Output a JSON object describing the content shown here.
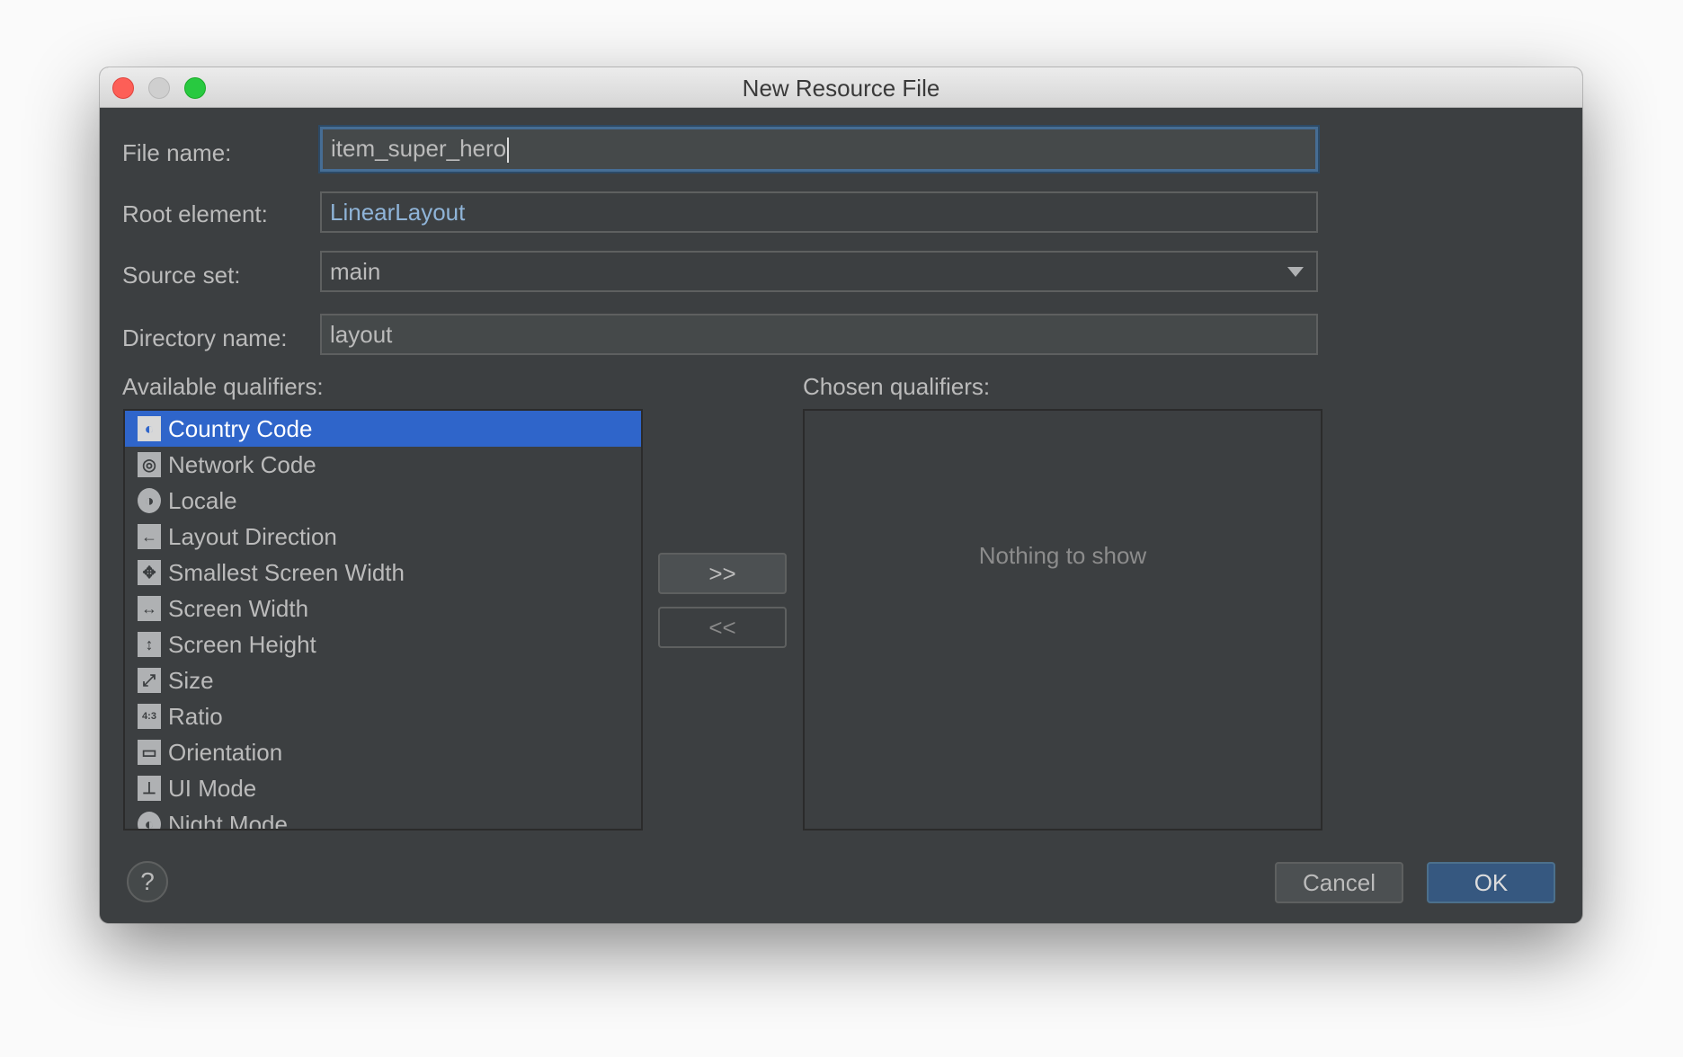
{
  "window": {
    "title": "New Resource File"
  },
  "form": {
    "file_name": {
      "label": "File name:",
      "value": "item_super_hero"
    },
    "root_element": {
      "label": "Root element:",
      "value": "LinearLayout"
    },
    "source_set": {
      "label": "Source set:",
      "value": "main"
    },
    "directory_name": {
      "label": "Directory name:",
      "value": "layout"
    }
  },
  "available": {
    "label": "Available qualifiers:",
    "items": [
      {
        "label": "Country Code",
        "icon": "country-code-icon",
        "glyph": "◐",
        "selected": true
      },
      {
        "label": "Network Code",
        "icon": "network-code-icon",
        "glyph": "◎"
      },
      {
        "label": "Locale",
        "icon": "globe-icon",
        "glyph": "◑"
      },
      {
        "label": "Layout Direction",
        "icon": "layout-direction-icon",
        "glyph": "←"
      },
      {
        "label": "Smallest Screen Width",
        "icon": "smallest-screen-width-icon",
        "glyph": "✥"
      },
      {
        "label": "Screen Width",
        "icon": "screen-width-icon",
        "glyph": "↔"
      },
      {
        "label": "Screen Height",
        "icon": "screen-height-icon",
        "glyph": "↕"
      },
      {
        "label": "Size",
        "icon": "size-icon",
        "glyph": "⤢"
      },
      {
        "label": "Ratio",
        "icon": "ratio-icon",
        "glyph": "4:3"
      },
      {
        "label": "Orientation",
        "icon": "orientation-icon",
        "glyph": "▭"
      },
      {
        "label": "UI Mode",
        "icon": "ui-mode-icon",
        "glyph": "⊥"
      },
      {
        "label": "Night Mode",
        "icon": "night-mode-icon",
        "glyph": "◐"
      }
    ]
  },
  "chosen": {
    "label": "Chosen qualifiers:",
    "empty_text": "Nothing to show"
  },
  "buttons": {
    "add": ">>",
    "remove": "<<",
    "cancel": "Cancel",
    "ok": "OK",
    "help": "?"
  },
  "colors": {
    "background": "#3c3f41",
    "selection": "#2f65ca",
    "ok": "#365880"
  }
}
